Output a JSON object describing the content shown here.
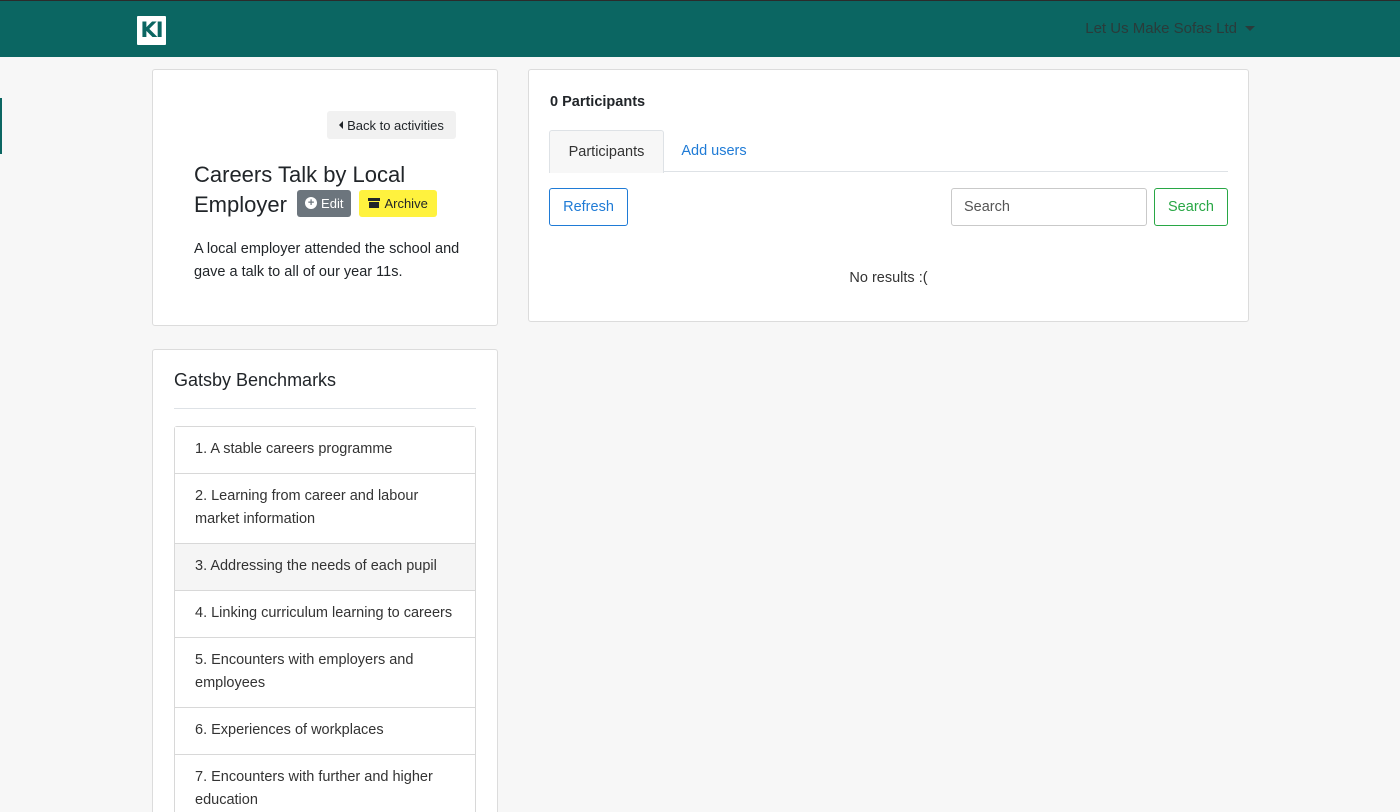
{
  "navbar": {
    "brand": "KI",
    "org_name": "Let Us Make Sofas Ltd",
    "colors": {
      "primary": "#0b6662"
    }
  },
  "activity": {
    "back_label": "Back to activities",
    "title": "Careers Talk by Local Employer",
    "edit_label": "Edit",
    "archive_label": "Archive",
    "description": "A local employer attended the school and gave a talk to all of our year 11s."
  },
  "participants": {
    "count_label": "0 Participants",
    "tabs": [
      {
        "label": "Participants",
        "active": true
      },
      {
        "label": "Add users",
        "active": false
      }
    ],
    "refresh_label": "Refresh",
    "search_placeholder": "Search",
    "search_button": "Search",
    "empty_text": "No results :("
  },
  "gatsby": {
    "title": "Gatsby Benchmarks",
    "items": [
      {
        "label": "1. A stable careers programme"
      },
      {
        "label": "2. Learning from career and labour market information"
      },
      {
        "label": "3. Addressing the needs of each pupil",
        "hovered": true
      },
      {
        "label": "4. Linking curriculum learning to careers"
      },
      {
        "label": "5. Encounters with employers and employees"
      },
      {
        "label": "6. Experiences of workplaces"
      },
      {
        "label": "7. Encounters with further and higher education"
      }
    ]
  }
}
